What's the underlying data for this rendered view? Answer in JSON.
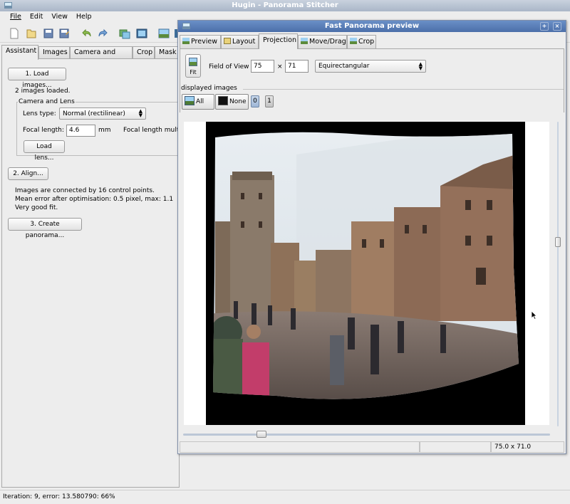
{
  "main_window": {
    "title": "Hugin - Panorama Stitcher",
    "menus": [
      "File",
      "Edit",
      "View",
      "Help"
    ],
    "toolbar_icons": [
      "new-icon",
      "open-icon",
      "save-icon",
      "save-as-icon",
      "undo-icon",
      "redo-icon",
      "add-images-icon",
      "add-series-icon",
      "preview-icon",
      "preview-gl-icon"
    ],
    "left_tabs": [
      "Assistant",
      "Images",
      "Camera and Lens",
      "Crop",
      "Mask"
    ],
    "assistant": {
      "load_images_button": "1. Load images...",
      "images_loaded": "2 images loaded.",
      "camera_group_title": "Camera and Lens",
      "lens_type_label": "Lens type:",
      "lens_type_value": "Normal (rectilinear)",
      "focal_length_label": "Focal length:",
      "focal_length_value": "4.6",
      "focal_length_unit": "mm",
      "focal_length_multiplier_label": "Focal length multi",
      "load_lens_button": "Load lens...",
      "align_button": "2. Align...",
      "align_info_1": "Images are connected by 16 control points.",
      "align_info_2": "Mean error after optimisation: 0.5 pixel, max: 1.1",
      "align_info_3": "Very good fit.",
      "create_panorama_button": "3. Create panorama..."
    },
    "status": "Iteration: 9, error: 13.580790: 66%"
  },
  "preview_window": {
    "title": "Fast Panorama preview",
    "tabs": [
      "Preview",
      "Layout",
      "Projection",
      "Move/Drag",
      "Crop"
    ],
    "active_tab": "Projection",
    "fit_label": "Fit",
    "fov_label": "Field of View",
    "fov_h": "75",
    "fov_separator": "×",
    "fov_v": "71",
    "projection": "Equirectangular",
    "displayed_images_label": "displayed images",
    "all_button": "All",
    "none_button": "None",
    "image_buttons": [
      "0",
      "1"
    ],
    "status_fov": "75.0 x 71.0"
  }
}
